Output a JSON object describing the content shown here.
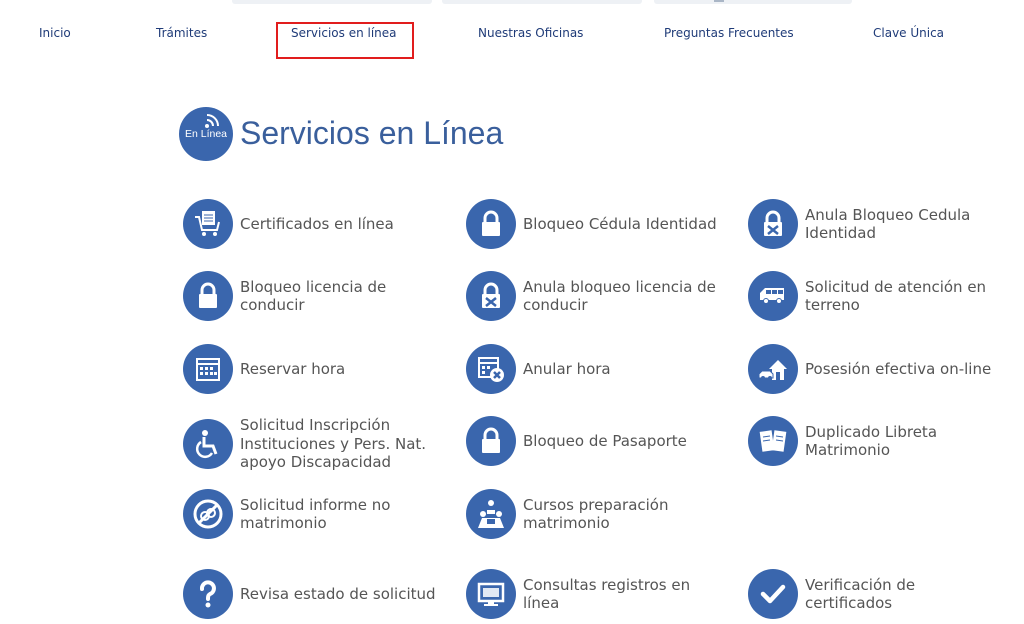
{
  "nav": {
    "items": [
      {
        "label": "Inicio"
      },
      {
        "label": "Trámites"
      },
      {
        "label": "Servicios en línea"
      },
      {
        "label": "Nuestras Oficinas"
      },
      {
        "label": "Preguntas Frecuentes"
      },
      {
        "label": "Clave Única"
      }
    ]
  },
  "header": {
    "badge_text": "En Línea",
    "title": "Servicios en Línea"
  },
  "services": [
    {
      "label": "Certificados en línea",
      "icon": "cart-certificate-icon"
    },
    {
      "label": "Bloqueo Cédula Identidad",
      "icon": "padlock-icon"
    },
    {
      "label": "Anula Bloqueo Cedula Identidad",
      "icon": "unlock-cross-icon"
    },
    {
      "label": "Bloqueo licencia de conducir",
      "icon": "padlock-icon"
    },
    {
      "label": "Anula bloqueo licencia de conducir",
      "icon": "unlock-cross-icon"
    },
    {
      "label": "Solicitud de atención en terreno",
      "icon": "van-icon"
    },
    {
      "label": "Reservar hora",
      "icon": "calendar-icon"
    },
    {
      "label": "Anular hora",
      "icon": "calendar-cancel-icon"
    },
    {
      "label": "Posesión efectiva on-line",
      "icon": "house-car-icon"
    },
    {
      "label": "Solicitud Inscripción Instituciones y Pers. Nat. apoyo Discapacidad",
      "icon": "wheelchair-icon"
    },
    {
      "label": "Bloqueo de Pasaporte",
      "icon": "padlock-icon"
    },
    {
      "label": "Duplicado Libreta Matrimonio",
      "icon": "marriage-booklet-icon"
    },
    {
      "label": "Solicitud informe no matrimonio",
      "icon": "no-rings-icon"
    },
    {
      "label": "Cursos preparación matrimonio",
      "icon": "couple-course-icon"
    },
    {
      "label": "Revisa estado de solicitud",
      "icon": "question-icon"
    },
    {
      "label": "Consultas registros en línea",
      "icon": "monitor-icon"
    },
    {
      "label": "Verificación de certificados",
      "icon": "checkmark-icon"
    }
  ],
  "colors": {
    "accent": "#3a66ad",
    "nav_text": "#1f3b78",
    "title_text": "#3a5f9c",
    "highlight_border": "#e11d1d"
  }
}
